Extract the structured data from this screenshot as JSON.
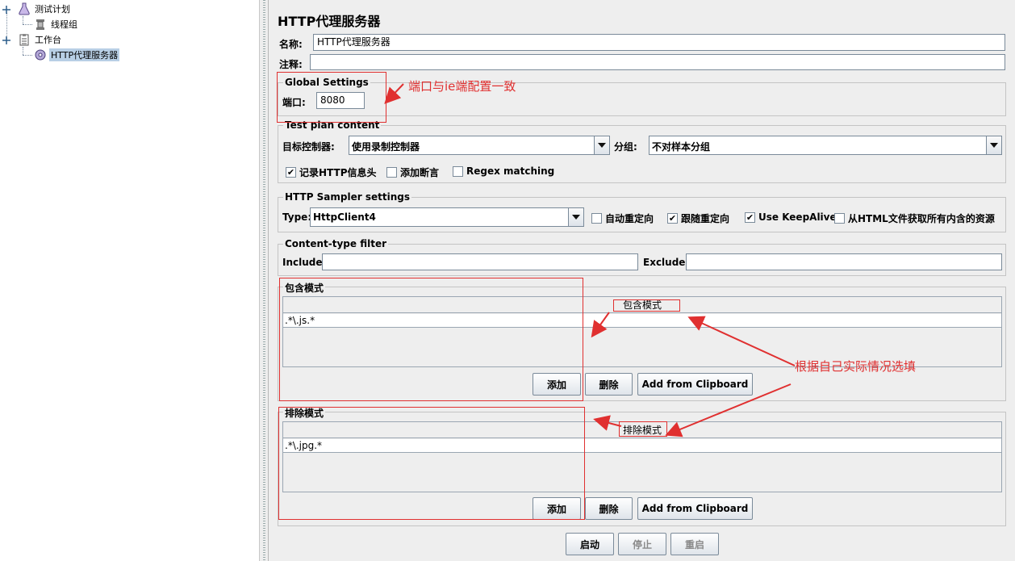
{
  "tree": {
    "items": [
      {
        "label": "测试计划"
      },
      {
        "label": "线程组"
      },
      {
        "label": "工作台"
      },
      {
        "label": "HTTP代理服务器"
      }
    ]
  },
  "panel": {
    "title": "HTTP代理服务器",
    "name_label": "名称:",
    "name_value": "HTTP代理服务器",
    "comment_label": "注释:",
    "comment_value": ""
  },
  "global_settings": {
    "title": "Global Settings",
    "port_label": "端口:",
    "port_value": "8080"
  },
  "test_plan_content": {
    "title": "Test plan content",
    "target_label": "目标控制器:",
    "target_value": "使用录制控制器",
    "grouping_label": "分组:",
    "grouping_value": "不对样本分组",
    "checkboxes": [
      {
        "label": "记录HTTP信息头",
        "checked": true
      },
      {
        "label": "添加断言",
        "checked": false
      },
      {
        "label": "Regex matching",
        "checked": false
      }
    ]
  },
  "sampler_settings": {
    "title": "HTTP Sampler settings",
    "type_label": "Type:",
    "type_value": "HttpClient4",
    "checkboxes": [
      {
        "label": "自动重定向",
        "checked": false
      },
      {
        "label": "跟随重定向",
        "checked": true
      },
      {
        "label": "Use KeepAlive",
        "checked": true
      },
      {
        "label": "从HTML文件获取所有内含的资源",
        "checked": false
      }
    ]
  },
  "content_type_filter": {
    "title": "Content-type filter",
    "include_label": "Include:",
    "include_value": "",
    "exclude_label": "Exclude:",
    "exclude_value": ""
  },
  "include_patterns": {
    "title": "包含模式",
    "column_header": "包含模式",
    "rows": [
      ".*\\.js.*"
    ],
    "add_label": "添加",
    "delete_label": "删除",
    "clipboard_label": "Add from Clipboard"
  },
  "exclude_patterns": {
    "title": "排除模式",
    "column_header": "排除模式",
    "rows": [
      ".*\\.jpg.*"
    ],
    "add_label": "添加",
    "delete_label": "删除",
    "clipboard_label": "Add from Clipboard"
  },
  "controls": {
    "start_label": "启动",
    "stop_label": "停止",
    "restart_label": "重启"
  },
  "annotations": {
    "port_note": "端口与ie端配置一致",
    "patterns_note": "根据自己实际情况选填",
    "color": "#e03030"
  },
  "colors": {
    "selection": "#b8cfe5",
    "panel_bg": "#eeeeee"
  }
}
